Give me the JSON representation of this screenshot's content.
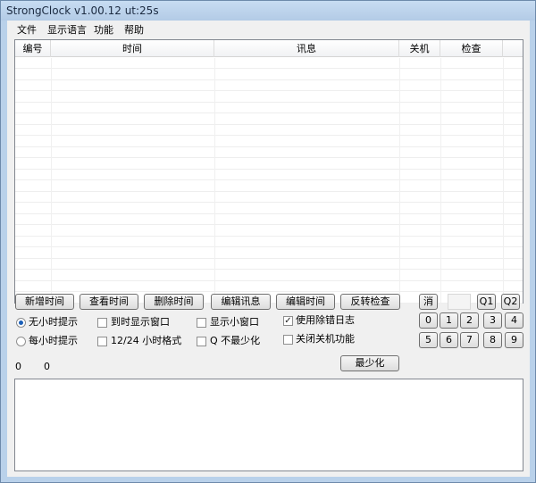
{
  "window": {
    "title": "StrongClock v1.00.12 ut:25s"
  },
  "menu": [
    "文件",
    "显示语言",
    "功能",
    "帮助"
  ],
  "table": {
    "columns": [
      "编号",
      "时间",
      "讯息",
      "关机",
      "检查"
    ],
    "rows": []
  },
  "buttons": {
    "add_time": "新增时间",
    "view_time": "查看时间",
    "delete_time": "删除时间",
    "edit_message": "编辑讯息",
    "edit_time": "编辑时间",
    "invert_check": "反转检查",
    "cancel": "消",
    "q1": "Q1",
    "q2": "Q2",
    "minimize": "最少化"
  },
  "digits": [
    "0",
    "1",
    "2",
    "3",
    "4",
    "5",
    "6",
    "7",
    "8",
    "9"
  ],
  "options": {
    "radio_no_hourly": "无小时提示",
    "radio_every_hour": "每小时提示",
    "show_window_on_time": "到时显示窗口",
    "format_12_24": "12/24 小时格式",
    "show_small_window": "显示小窗口",
    "q_no_minimize": "Q 不最少化",
    "use_debug_log": "使用除错日志",
    "disable_shutdown": "关闭关机功能"
  },
  "state": {
    "radio_selected": "no_hourly",
    "use_debug_log_checked": true
  },
  "counters": {
    "left": "0",
    "right": "0"
  },
  "log_text": ""
}
